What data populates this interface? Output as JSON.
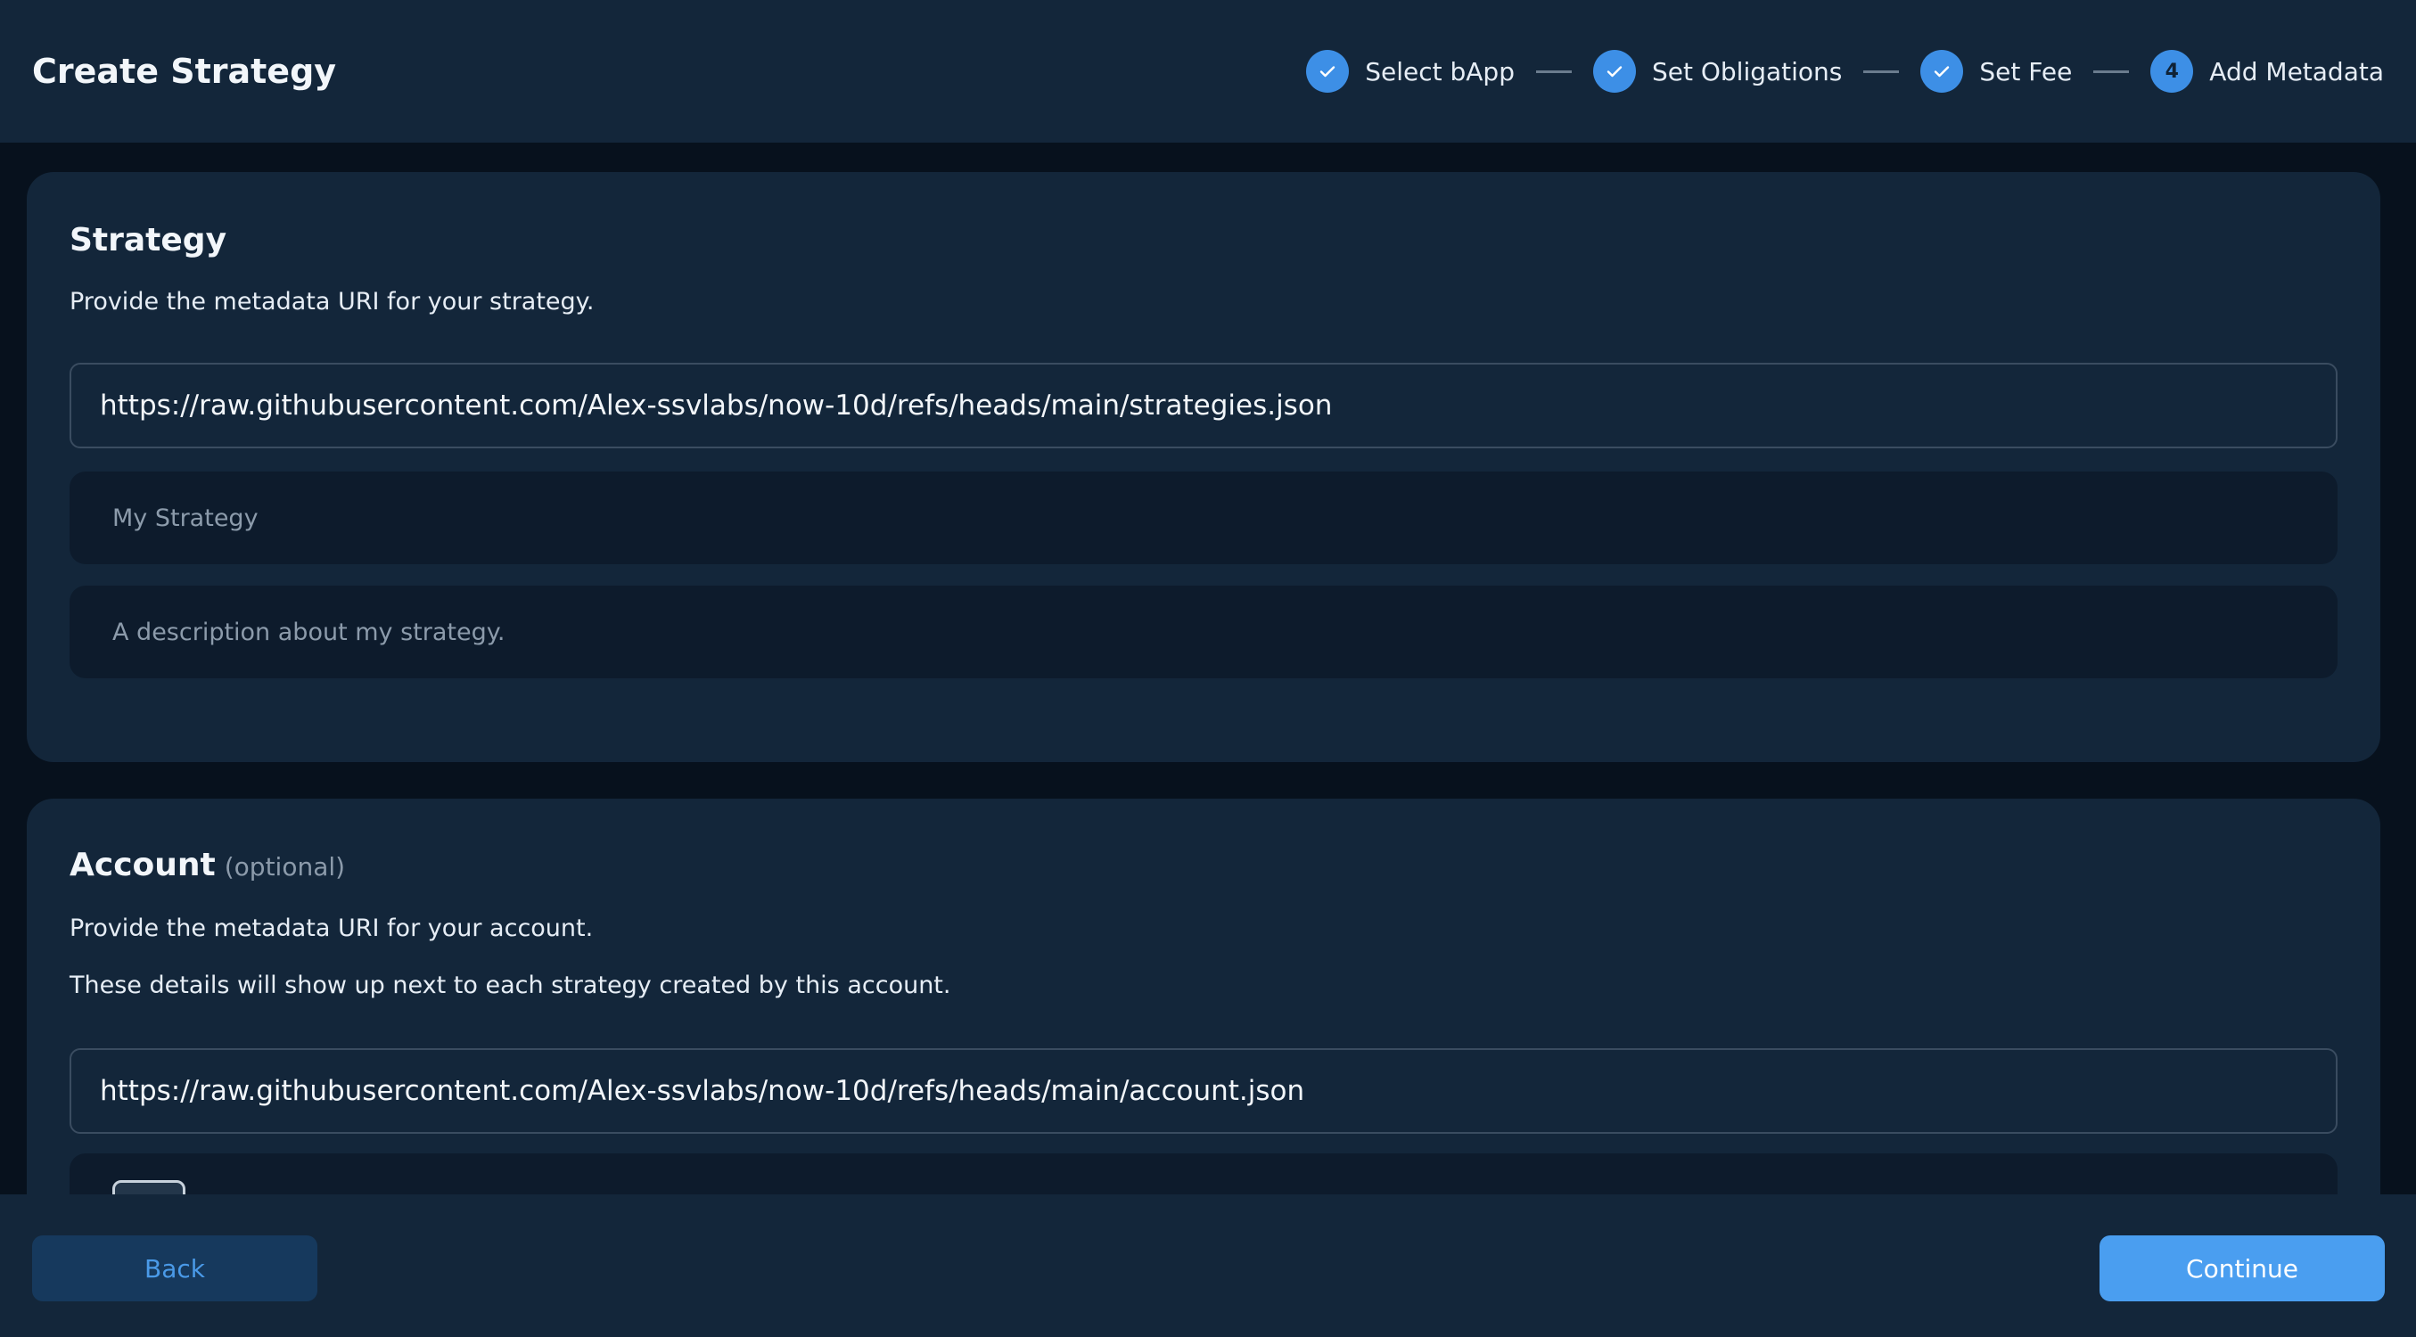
{
  "header": {
    "title": "Create Strategy",
    "steps": [
      {
        "label": "Select bApp",
        "status": "complete",
        "icon": "check-icon"
      },
      {
        "label": "Set Obligations",
        "status": "complete",
        "icon": "check-icon"
      },
      {
        "label": "Set Fee",
        "status": "complete",
        "icon": "check-icon"
      },
      {
        "label": "Add Metadata",
        "status": "current",
        "number": "4"
      }
    ]
  },
  "strategy": {
    "title": "Strategy",
    "description": "Provide the metadata URI for your strategy.",
    "uri_value": "https://raw.githubusercontent.com/Alex-ssvlabs/now-10d/refs/heads/main/strategies.json",
    "name_value": "My Strategy",
    "description_value": "A description about my strategy."
  },
  "account": {
    "title": "Account",
    "optional_label": "(optional)",
    "description_1": "Provide the metadata URI for your account.",
    "description_2": "These details will show up next to each strategy created by this account.",
    "uri_value": "https://raw.githubusercontent.com/Alex-ssvlabs/now-10d/refs/heads/main/account.json"
  },
  "footer": {
    "back_label": "Back",
    "continue_label": "Continue"
  },
  "colors": {
    "accent": "#3d8fe6",
    "background": "#07111d",
    "panel": "#13263a"
  }
}
